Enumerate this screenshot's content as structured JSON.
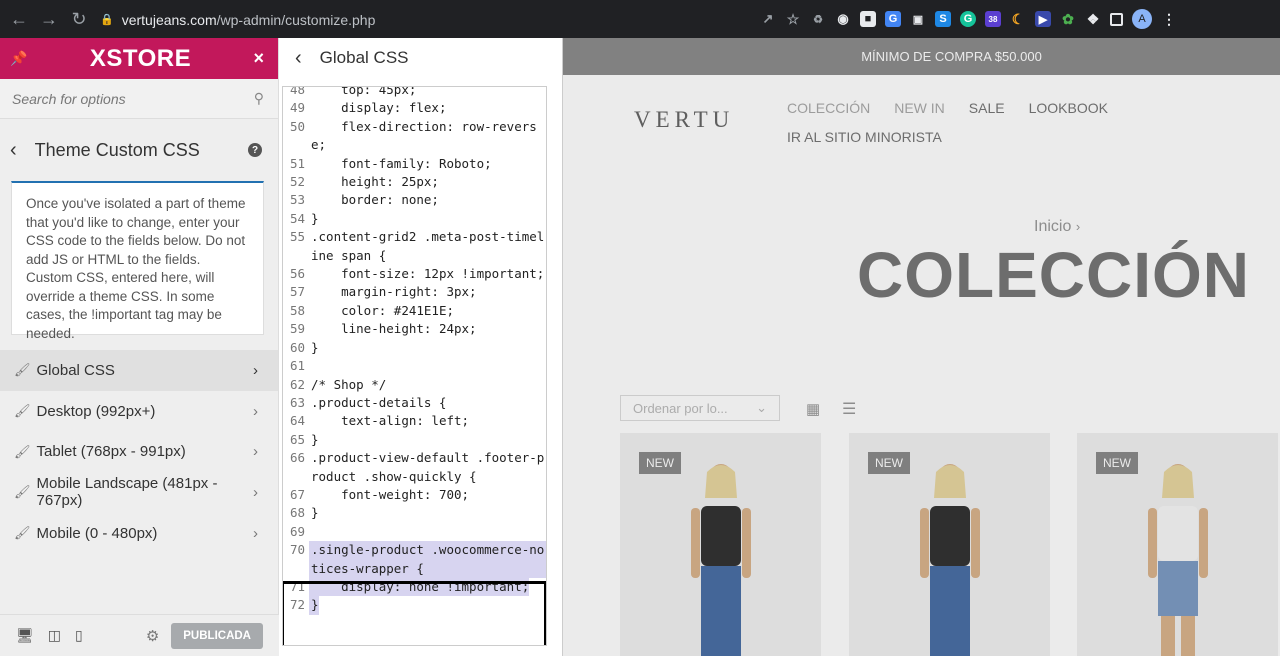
{
  "browser": {
    "url_host": "vertujeans.com",
    "url_path": "/wp-admin/customize.php",
    "ext_badge": "38",
    "avatar_letter": "A"
  },
  "customizer": {
    "brand": "XSTORE",
    "search_placeholder": "Search for options",
    "section_title": "Theme Custom CSS",
    "description": "Once you've isolated a part of theme that you'd like to change, enter your CSS code to the fields below. Do not add JS or HTML to the fields. Custom CSS, entered here, will override a theme CSS. In some cases, the !important tag may be needed.",
    "menu": [
      {
        "label": "Global CSS"
      },
      {
        "label": "Desktop (992px+)"
      },
      {
        "label": "Tablet (768px - 991px)"
      },
      {
        "label": "Mobile Landscape (481px - 767px)"
      },
      {
        "label": "Mobile (0 - 480px)"
      }
    ],
    "publish_label": "PUBLICADA"
  },
  "code_panel": {
    "title": "Global CSS",
    "lines": [
      {
        "n": "48",
        "t": "    top: 45px;"
      },
      {
        "n": "49",
        "t": "    display: flex;"
      },
      {
        "n": "50",
        "t": "    flex-direction: row-reverse;"
      },
      {
        "n": "51",
        "t": "    font-family: Roboto;"
      },
      {
        "n": "52",
        "t": "    height: 25px;"
      },
      {
        "n": "53",
        "t": "    border: none;"
      },
      {
        "n": "54",
        "t": "}"
      },
      {
        "n": "55",
        "t": ".content-grid2 .meta-post-timeline span {"
      },
      {
        "n": "56",
        "t": "    font-size: 12px !important;"
      },
      {
        "n": "57",
        "t": "    margin-right: 3px;"
      },
      {
        "n": "58",
        "t": "    color: #241E1E;"
      },
      {
        "n": "59",
        "t": "    line-height: 24px;"
      },
      {
        "n": "60",
        "t": "}"
      },
      {
        "n": "61",
        "t": ""
      },
      {
        "n": "62",
        "t": "/* Shop */"
      },
      {
        "n": "63",
        "t": ".product-details {"
      },
      {
        "n": "64",
        "t": "    text-align: left;"
      },
      {
        "n": "65",
        "t": "}"
      },
      {
        "n": "66",
        "t": ".product-view-default .footer-product .show-quickly {"
      },
      {
        "n": "67",
        "t": "    font-weight: 700;"
      },
      {
        "n": "68",
        "t": "}"
      },
      {
        "n": "69",
        "t": ""
      },
      {
        "n": "70",
        "t": ".single-product .woocommerce-notices-wrapper {"
      },
      {
        "n": "71",
        "t": "    display: none !important;"
      },
      {
        "n": "72",
        "t": "}"
      }
    ]
  },
  "preview": {
    "promo": "MÍNIMO DE COMPRA $50.000",
    "logo": "VERTU",
    "nav": [
      "COLECCIÓN",
      "NEW IN",
      "SALE",
      "LOOKBOOK",
      "IR AL SITIO MINORISTA"
    ],
    "breadcrumb": "Inicio",
    "page_title": "COLECCIÓN",
    "sort_label": "Ordenar por lo...",
    "product_badge": "NEW"
  }
}
